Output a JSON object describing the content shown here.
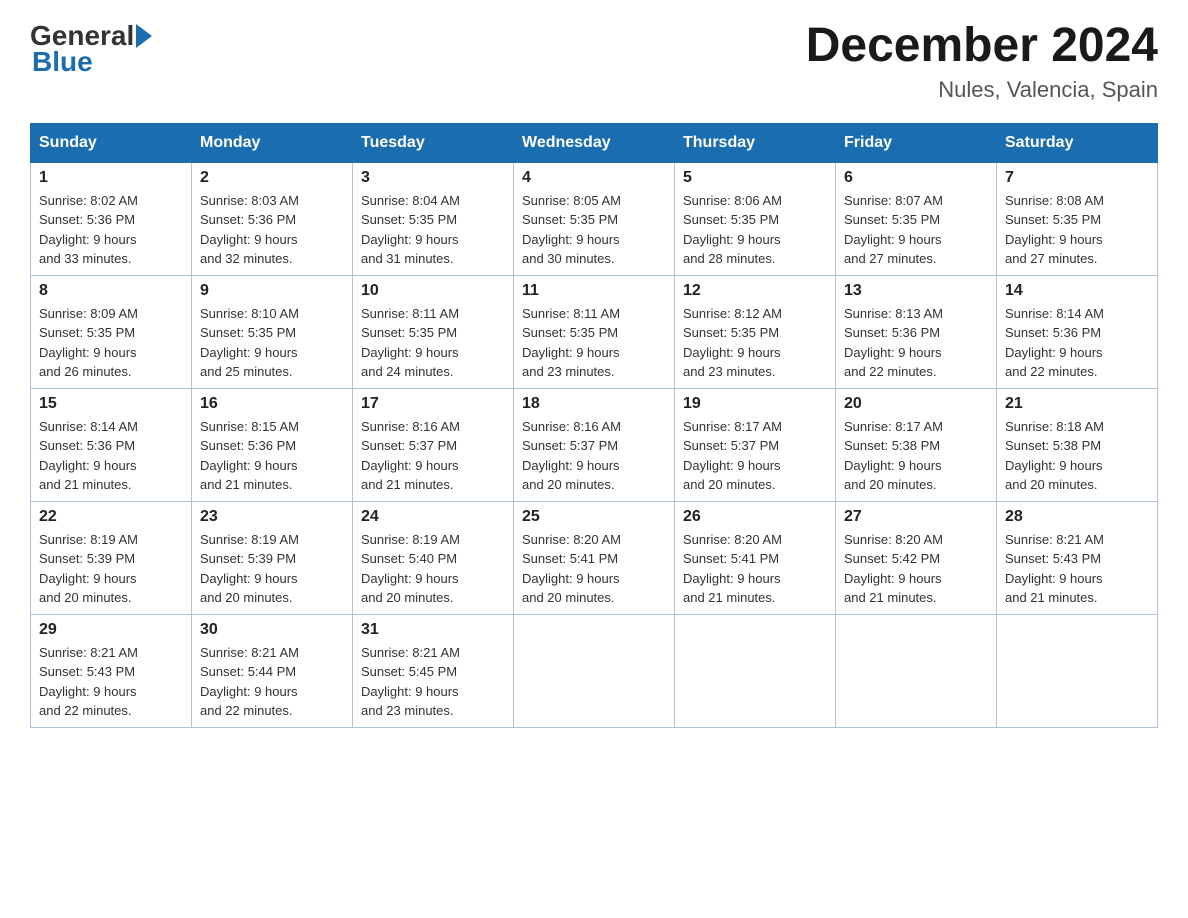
{
  "header": {
    "logo_general": "General",
    "logo_blue": "Blue",
    "month_title": "December 2024",
    "location": "Nules, Valencia, Spain"
  },
  "columns": [
    "Sunday",
    "Monday",
    "Tuesday",
    "Wednesday",
    "Thursday",
    "Friday",
    "Saturday"
  ],
  "weeks": [
    [
      {
        "day": "1",
        "sunrise": "Sunrise: 8:02 AM",
        "sunset": "Sunset: 5:36 PM",
        "daylight": "Daylight: 9 hours",
        "minutes": "and 33 minutes."
      },
      {
        "day": "2",
        "sunrise": "Sunrise: 8:03 AM",
        "sunset": "Sunset: 5:36 PM",
        "daylight": "Daylight: 9 hours",
        "minutes": "and 32 minutes."
      },
      {
        "day": "3",
        "sunrise": "Sunrise: 8:04 AM",
        "sunset": "Sunset: 5:35 PM",
        "daylight": "Daylight: 9 hours",
        "minutes": "and 31 minutes."
      },
      {
        "day": "4",
        "sunrise": "Sunrise: 8:05 AM",
        "sunset": "Sunset: 5:35 PM",
        "daylight": "Daylight: 9 hours",
        "minutes": "and 30 minutes."
      },
      {
        "day": "5",
        "sunrise": "Sunrise: 8:06 AM",
        "sunset": "Sunset: 5:35 PM",
        "daylight": "Daylight: 9 hours",
        "minutes": "and 28 minutes."
      },
      {
        "day": "6",
        "sunrise": "Sunrise: 8:07 AM",
        "sunset": "Sunset: 5:35 PM",
        "daylight": "Daylight: 9 hours",
        "minutes": "and 27 minutes."
      },
      {
        "day": "7",
        "sunrise": "Sunrise: 8:08 AM",
        "sunset": "Sunset: 5:35 PM",
        "daylight": "Daylight: 9 hours",
        "minutes": "and 27 minutes."
      }
    ],
    [
      {
        "day": "8",
        "sunrise": "Sunrise: 8:09 AM",
        "sunset": "Sunset: 5:35 PM",
        "daylight": "Daylight: 9 hours",
        "minutes": "and 26 minutes."
      },
      {
        "day": "9",
        "sunrise": "Sunrise: 8:10 AM",
        "sunset": "Sunset: 5:35 PM",
        "daylight": "Daylight: 9 hours",
        "minutes": "and 25 minutes."
      },
      {
        "day": "10",
        "sunrise": "Sunrise: 8:11 AM",
        "sunset": "Sunset: 5:35 PM",
        "daylight": "Daylight: 9 hours",
        "minutes": "and 24 minutes."
      },
      {
        "day": "11",
        "sunrise": "Sunrise: 8:11 AM",
        "sunset": "Sunset: 5:35 PM",
        "daylight": "Daylight: 9 hours",
        "minutes": "and 23 minutes."
      },
      {
        "day": "12",
        "sunrise": "Sunrise: 8:12 AM",
        "sunset": "Sunset: 5:35 PM",
        "daylight": "Daylight: 9 hours",
        "minutes": "and 23 minutes."
      },
      {
        "day": "13",
        "sunrise": "Sunrise: 8:13 AM",
        "sunset": "Sunset: 5:36 PM",
        "daylight": "Daylight: 9 hours",
        "minutes": "and 22 minutes."
      },
      {
        "day": "14",
        "sunrise": "Sunrise: 8:14 AM",
        "sunset": "Sunset: 5:36 PM",
        "daylight": "Daylight: 9 hours",
        "minutes": "and 22 minutes."
      }
    ],
    [
      {
        "day": "15",
        "sunrise": "Sunrise: 8:14 AM",
        "sunset": "Sunset: 5:36 PM",
        "daylight": "Daylight: 9 hours",
        "minutes": "and 21 minutes."
      },
      {
        "day": "16",
        "sunrise": "Sunrise: 8:15 AM",
        "sunset": "Sunset: 5:36 PM",
        "daylight": "Daylight: 9 hours",
        "minutes": "and 21 minutes."
      },
      {
        "day": "17",
        "sunrise": "Sunrise: 8:16 AM",
        "sunset": "Sunset: 5:37 PM",
        "daylight": "Daylight: 9 hours",
        "minutes": "and 21 minutes."
      },
      {
        "day": "18",
        "sunrise": "Sunrise: 8:16 AM",
        "sunset": "Sunset: 5:37 PM",
        "daylight": "Daylight: 9 hours",
        "minutes": "and 20 minutes."
      },
      {
        "day": "19",
        "sunrise": "Sunrise: 8:17 AM",
        "sunset": "Sunset: 5:37 PM",
        "daylight": "Daylight: 9 hours",
        "minutes": "and 20 minutes."
      },
      {
        "day": "20",
        "sunrise": "Sunrise: 8:17 AM",
        "sunset": "Sunset: 5:38 PM",
        "daylight": "Daylight: 9 hours",
        "minutes": "and 20 minutes."
      },
      {
        "day": "21",
        "sunrise": "Sunrise: 8:18 AM",
        "sunset": "Sunset: 5:38 PM",
        "daylight": "Daylight: 9 hours",
        "minutes": "and 20 minutes."
      }
    ],
    [
      {
        "day": "22",
        "sunrise": "Sunrise: 8:19 AM",
        "sunset": "Sunset: 5:39 PM",
        "daylight": "Daylight: 9 hours",
        "minutes": "and 20 minutes."
      },
      {
        "day": "23",
        "sunrise": "Sunrise: 8:19 AM",
        "sunset": "Sunset: 5:39 PM",
        "daylight": "Daylight: 9 hours",
        "minutes": "and 20 minutes."
      },
      {
        "day": "24",
        "sunrise": "Sunrise: 8:19 AM",
        "sunset": "Sunset: 5:40 PM",
        "daylight": "Daylight: 9 hours",
        "minutes": "and 20 minutes."
      },
      {
        "day": "25",
        "sunrise": "Sunrise: 8:20 AM",
        "sunset": "Sunset: 5:41 PM",
        "daylight": "Daylight: 9 hours",
        "minutes": "and 20 minutes."
      },
      {
        "day": "26",
        "sunrise": "Sunrise: 8:20 AM",
        "sunset": "Sunset: 5:41 PM",
        "daylight": "Daylight: 9 hours",
        "minutes": "and 21 minutes."
      },
      {
        "day": "27",
        "sunrise": "Sunrise: 8:20 AM",
        "sunset": "Sunset: 5:42 PM",
        "daylight": "Daylight: 9 hours",
        "minutes": "and 21 minutes."
      },
      {
        "day": "28",
        "sunrise": "Sunrise: 8:21 AM",
        "sunset": "Sunset: 5:43 PM",
        "daylight": "Daylight: 9 hours",
        "minutes": "and 21 minutes."
      }
    ],
    [
      {
        "day": "29",
        "sunrise": "Sunrise: 8:21 AM",
        "sunset": "Sunset: 5:43 PM",
        "daylight": "Daylight: 9 hours",
        "minutes": "and 22 minutes."
      },
      {
        "day": "30",
        "sunrise": "Sunrise: 8:21 AM",
        "sunset": "Sunset: 5:44 PM",
        "daylight": "Daylight: 9 hours",
        "minutes": "and 22 minutes."
      },
      {
        "day": "31",
        "sunrise": "Sunrise: 8:21 AM",
        "sunset": "Sunset: 5:45 PM",
        "daylight": "Daylight: 9 hours",
        "minutes": "and 23 minutes."
      },
      {
        "day": "",
        "sunrise": "",
        "sunset": "",
        "daylight": "",
        "minutes": ""
      },
      {
        "day": "",
        "sunrise": "",
        "sunset": "",
        "daylight": "",
        "minutes": ""
      },
      {
        "day": "",
        "sunrise": "",
        "sunset": "",
        "daylight": "",
        "minutes": ""
      },
      {
        "day": "",
        "sunrise": "",
        "sunset": "",
        "daylight": "",
        "minutes": ""
      }
    ]
  ]
}
